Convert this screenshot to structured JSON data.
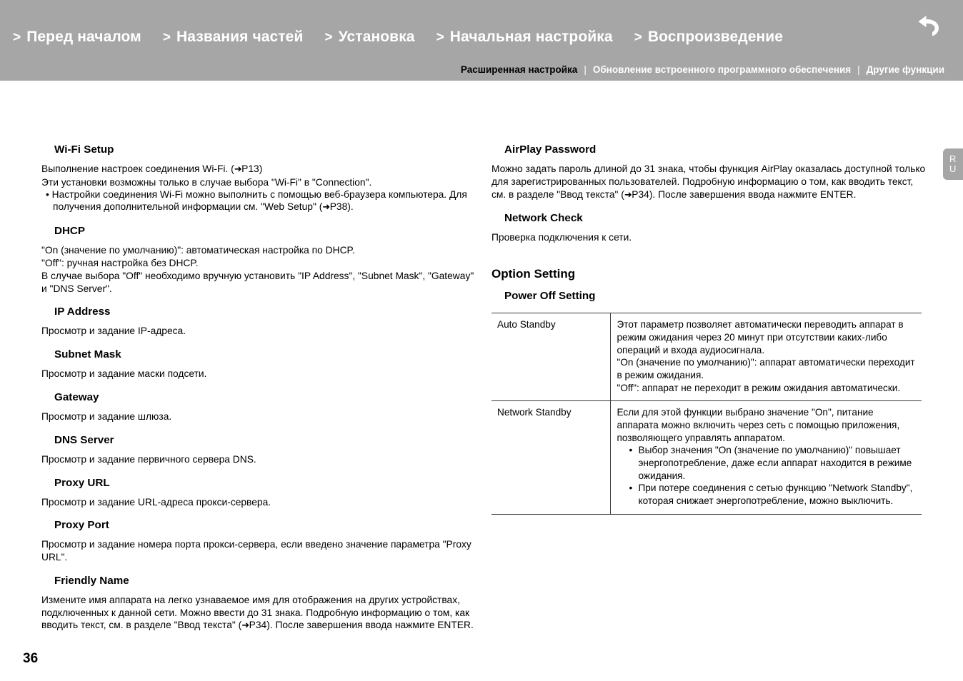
{
  "header": {
    "nav_items": [
      {
        "caret": ">",
        "label": "Перед началом"
      },
      {
        "caret": ">",
        "label": "Названия частей"
      },
      {
        "caret": ">",
        "label": "Установка"
      },
      {
        "caret": ">",
        "label": "Начальная настройка"
      },
      {
        "caret": ">",
        "label": "Воспроизведение"
      }
    ],
    "sub_nav": [
      {
        "label": "Расширенная настройка",
        "active": true
      },
      {
        "label": "Обновление встроенного программного обеспечения",
        "active": false
      },
      {
        "label": "Другие функции",
        "active": false
      }
    ],
    "separator": "|",
    "back_icon": "back-arrow-icon",
    "band_color": "#a6a6a6"
  },
  "side_tab": {
    "line1": "R",
    "line2": "U"
  },
  "left_column": {
    "wifi_setup": {
      "heading": "Wi-Fi Setup",
      "line1_a": "Выполнение настроек соединения Wi-Fi. (",
      "line1_arrow": "➜",
      "line1_b": "P13)",
      "line2": "Эти установки возможны только в случае выбора \"Wi-Fi\" в \"Connection\".",
      "bullet_a": "• Настройки соединения Wi-Fi можно выполнить с помощью веб-браузера компьютера. Для получения дополнительной информации см. \"Web Setup\" (",
      "bullet_arrow": "➜",
      "bullet_b": "P38)."
    },
    "dhcp": {
      "heading": "DHCP",
      "line1": "\"On (значение по умолчанию)\": автоматическая настройка по DHCP.",
      "line2": "\"Off\": ручная настройка без DHCP.",
      "line3": "В случае выбора \"Off\" необходимо вручную установить \"IP Address\", \"Subnet Mask\", \"Gateway\" и \"DNS Server\"."
    },
    "ip_address": {
      "heading": "IP Address",
      "body": "Просмотр и задание IP-адреса."
    },
    "subnet_mask": {
      "heading": "Subnet Mask",
      "body": "Просмотр и задание маски подсети."
    },
    "gateway": {
      "heading": "Gateway",
      "body": "Просмотр и задание шлюза."
    },
    "dns_server": {
      "heading": "DNS Server",
      "body": "Просмотр и задание первичного сервера DNS."
    },
    "proxy_url": {
      "heading": "Proxy URL",
      "body": "Просмотр и задание URL-адреса прокси-сервера."
    },
    "proxy_port": {
      "heading": "Proxy Port",
      "body": "Просмотр и задание номера порта прокси-сервера, если введено значение параметра \"Proxy URL\"."
    },
    "friendly_name": {
      "heading": "Friendly Name",
      "body_a": "Измените имя аппарата на легко узнаваемое имя для отображения на других устройствах, подключенных к данной сети. Можно ввести до 31 знака. Подробную информацию о том, как вводить текст, см. в разделе \"Ввод текста\" (",
      "body_arrow": "➜",
      "body_b": "P34). После завершения ввода нажмите ENTER."
    }
  },
  "right_column": {
    "airplay_password": {
      "heading": "AirPlay Password",
      "body_a": "Можно задать пароль длиной до 31 знака, чтобы функция AirPlay оказалась доступной только для зарегистрированных пользователей. Подробную информацию о том, как вводить текст, см. в разделе \"Ввод текста\" (",
      "body_arrow": "➜",
      "body_b": "P34). После завершения ввода нажмите ENTER."
    },
    "network_check": {
      "heading": "Network Check",
      "body": "Проверка подключения к сети."
    },
    "option_setting": {
      "section_heading": "Option Setting",
      "sub_heading": "Power Off Setting",
      "table": {
        "rows": [
          {
            "name": "Auto Standby",
            "lines": [
              "Этот параметр позволяет автоматически переводить аппарат в режим ожидания через 20 минут при отсутствии каких-либо операций и входа аудиосигнала.",
              "\"On (значение по умолчанию)\": аппарат автоматически переходит в режим ожидания.",
              "\"Off\": аппарат не переходит в режим ожидания автоматически."
            ],
            "bullets": []
          },
          {
            "name": "Network Standby",
            "lines": [
              "Если для этой функции выбрано значение \"On\", питание аппарата можно включить через сеть с помощью приложения, позволяющего управлять аппаратом."
            ],
            "bullets": [
              "Выбор значения \"On (значение по умолчанию)\" повышает энергопотребление, даже если аппарат находится в режиме ожидания.",
              "При потере соединения с сетью функцию \"Network Standby\", которая снижает энергопотребление, можно выключить."
            ]
          }
        ]
      }
    }
  },
  "footer": {
    "page_number": "36"
  }
}
